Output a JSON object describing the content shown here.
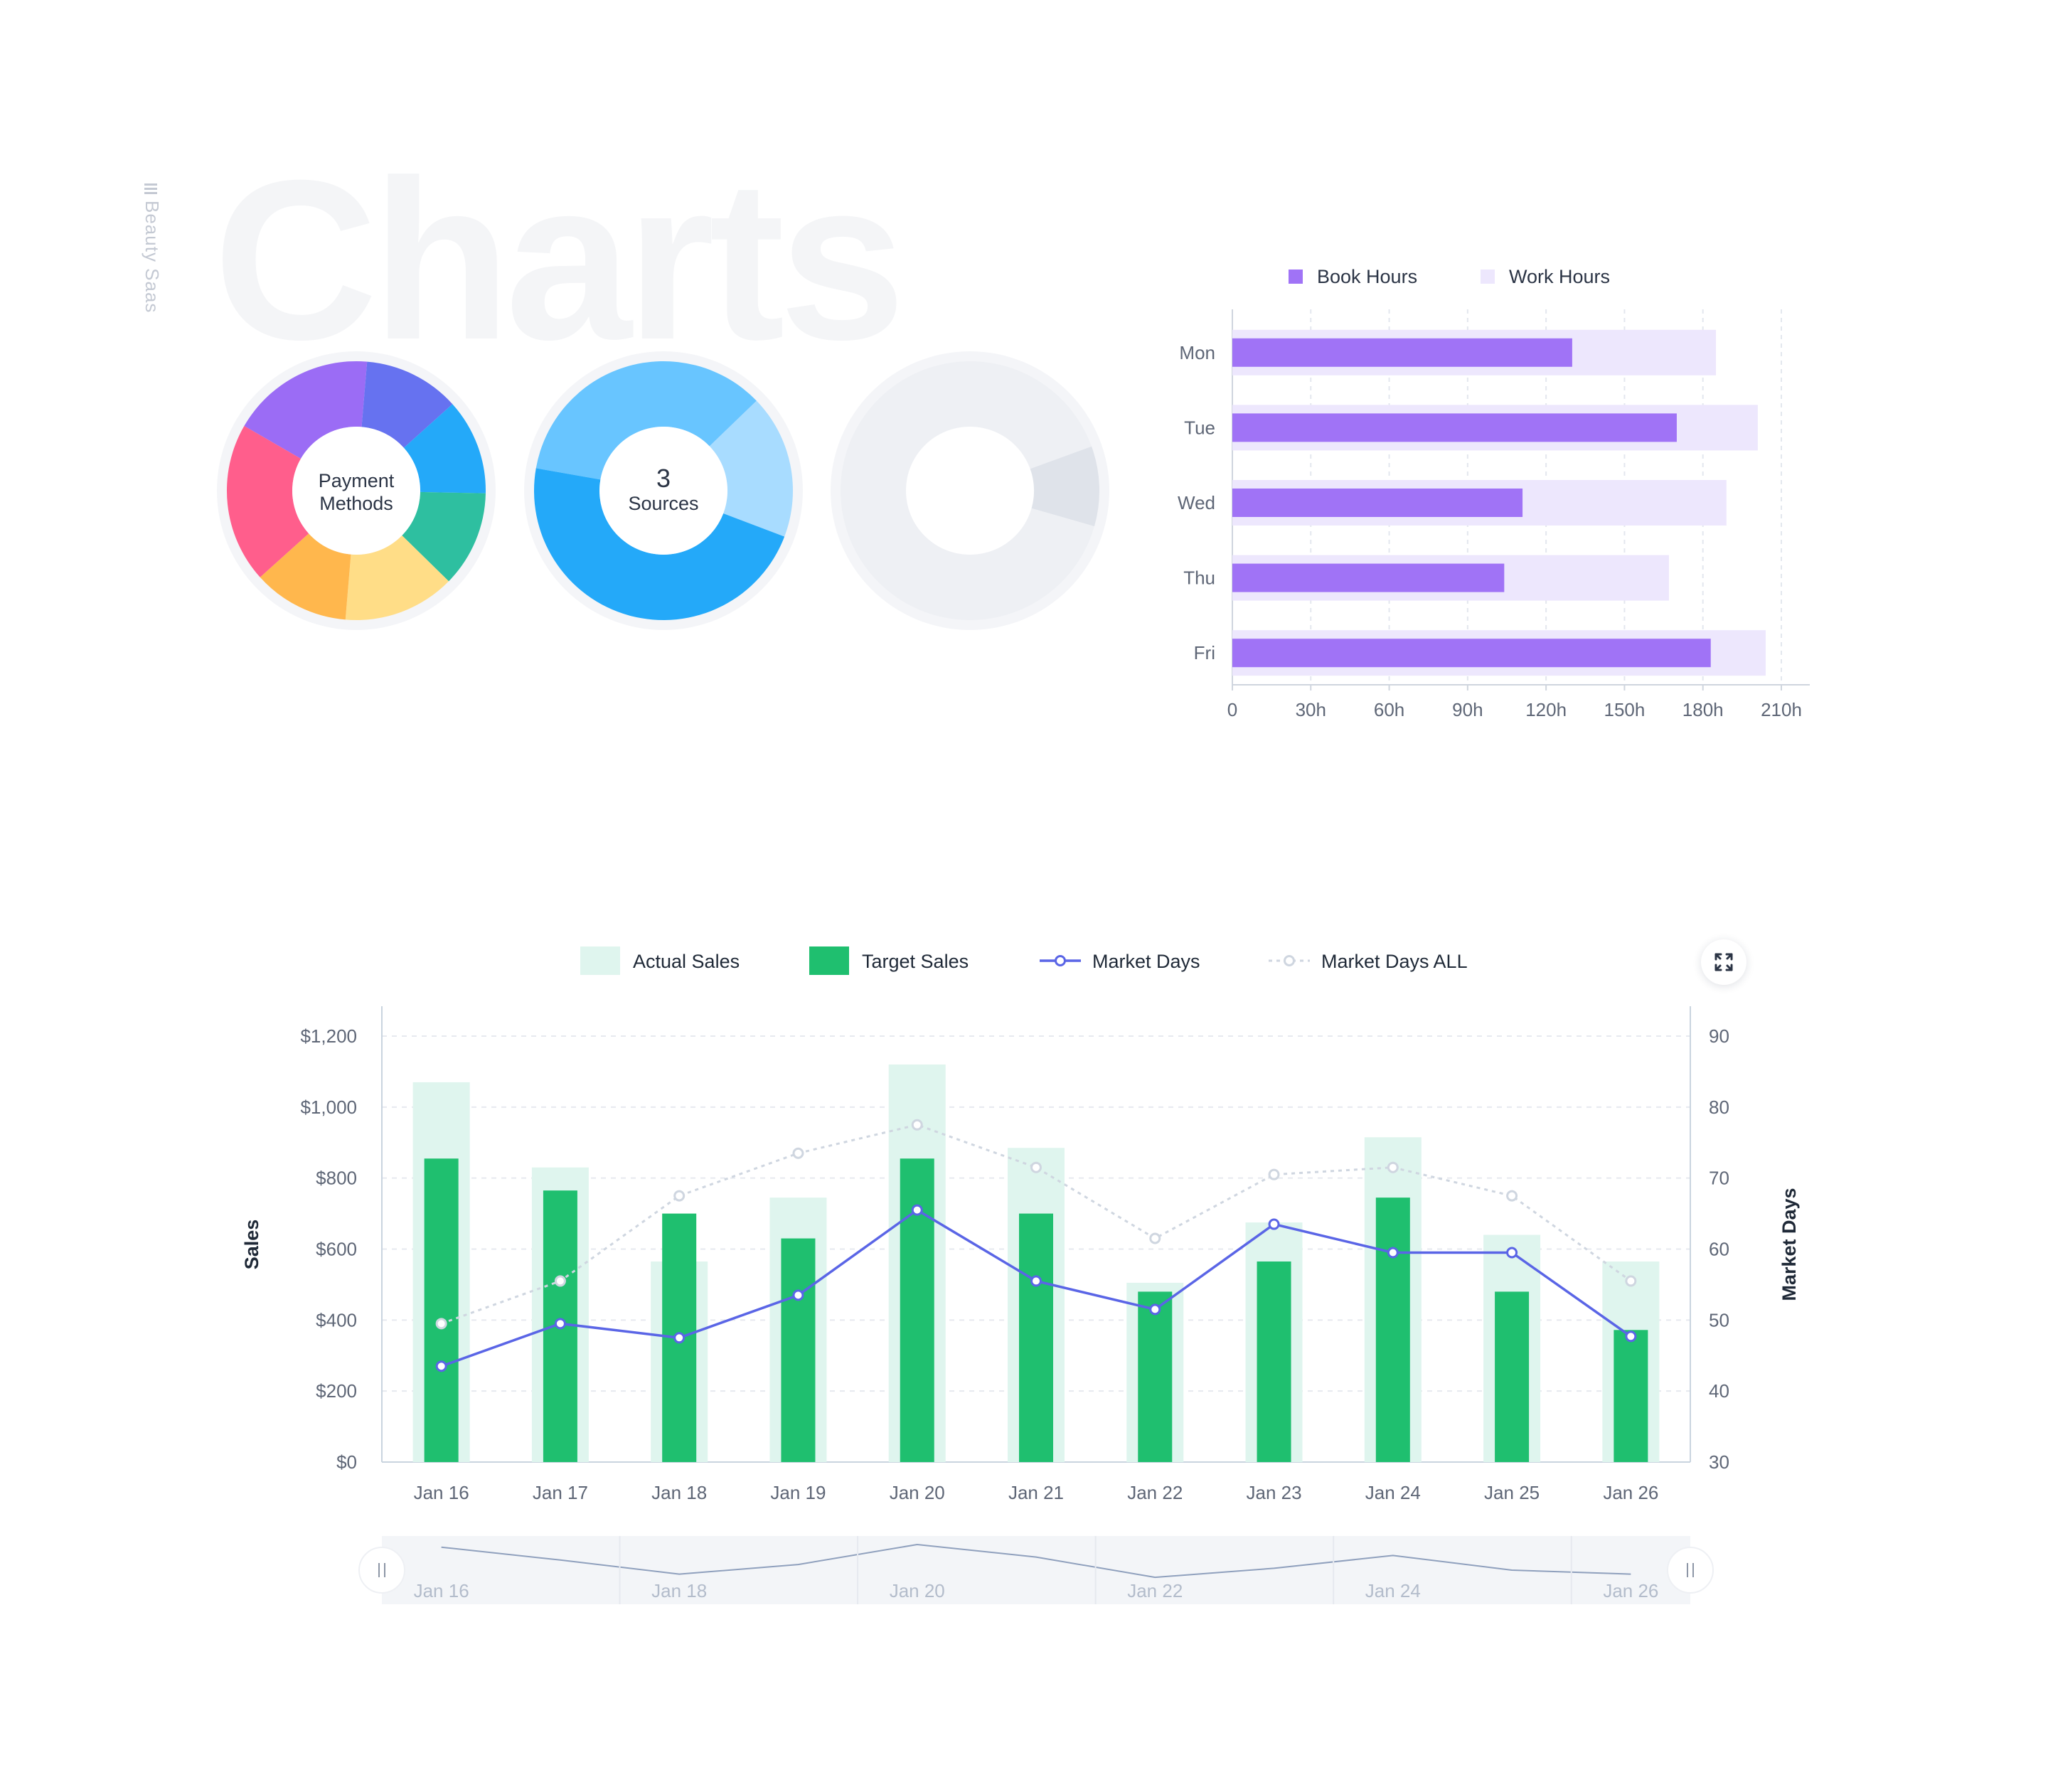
{
  "brand": {
    "label": "Beauty Saas"
  },
  "page_title": "Charts",
  "expand_icon": "expand-icon",
  "chart_data": [
    {
      "type": "pie",
      "variant": "donut",
      "center_label": [
        "Payment",
        "Methods"
      ],
      "slices": [
        {
          "value": 18,
          "color": "#9b6cf5"
        },
        {
          "value": 12,
          "color": "#6672f0"
        },
        {
          "value": 12,
          "color": "#24a9f9"
        },
        {
          "value": 12,
          "color": "#2ebfa0"
        },
        {
          "value": 14,
          "color": "#ffdd87"
        },
        {
          "value": 12,
          "color": "#ffb74d"
        },
        {
          "value": 20,
          "color": "#ff5e8c"
        }
      ]
    },
    {
      "type": "pie",
      "variant": "donut",
      "center_value": "3",
      "center_label": "Sources",
      "slices": [
        {
          "value": 35,
          "color": "#68c5ff"
        },
        {
          "value": 18,
          "color": "#a8dcff"
        },
        {
          "value": 47,
          "color": "#24a9f9"
        }
      ]
    },
    {
      "type": "pie",
      "variant": "donut",
      "slices": [
        {
          "value": 10,
          "color": "#dfe3ea"
        },
        {
          "value": 90,
          "color": "#eef0f4"
        }
      ]
    },
    {
      "type": "bar",
      "orientation": "horizontal",
      "categories": [
        "Mon",
        "Tue",
        "Wed",
        "Thu",
        "Fri"
      ],
      "series": [
        {
          "name": "Book Hours",
          "color": "#a073f6",
          "values": [
            130,
            170,
            111,
            104,
            183
          ]
        },
        {
          "name": "Work Hours",
          "color": "#ede7fd",
          "values": [
            185,
            201,
            189,
            167,
            204
          ]
        }
      ],
      "x_ticks": [
        0,
        30,
        60,
        90,
        120,
        150,
        180,
        210
      ],
      "x_tick_labels": [
        "0",
        "30h",
        "60h",
        "90h",
        "120h",
        "150h",
        "180h",
        "210h"
      ],
      "xlim": [
        0,
        210
      ],
      "grid": "vertical dashed",
      "legend": "top"
    },
    {
      "type": "bar",
      "categories": [
        "Jan 16",
        "Jan 17",
        "Jan 18",
        "Jan 19",
        "Jan 20",
        "Jan 21",
        "Jan 22",
        "Jan 23",
        "Jan 24",
        "Jan 25",
        "Jan 26"
      ],
      "series": [
        {
          "name": "Actual Sales",
          "type": "bar",
          "axis": "left",
          "color": "#dff5ee",
          "values": [
            1070,
            830,
            565,
            745,
            1120,
            885,
            505,
            675,
            915,
            640,
            565
          ]
        },
        {
          "name": "Target Sales",
          "type": "bar",
          "axis": "left",
          "color": "#1fbf6f",
          "values": [
            855,
            765,
            700,
            630,
            855,
            700,
            480,
            565,
            745,
            480,
            372
          ]
        },
        {
          "name": "Market Days",
          "type": "line",
          "axis": "right",
          "color": "#5a65e6",
          "values": [
            43.5,
            49.5,
            47.5,
            53.5,
            65.5,
            55.5,
            51.5,
            63.5,
            59.5,
            59.5,
            47.7
          ]
        },
        {
          "name": "Market Days ALL",
          "type": "line",
          "axis": "right",
          "style": "dashed",
          "color": "#cfd6e0",
          "values": [
            49.5,
            55.5,
            67.5,
            73.5,
            77.5,
            71.5,
            61.5,
            70.5,
            71.5,
            67.5,
            55.5
          ]
        }
      ],
      "ylabel": "Sales",
      "ylim": [
        0,
        1200
      ],
      "y_ticks": [
        "$0",
        "$200",
        "$400",
        "$600",
        "$800",
        "$1,000",
        "$1,200"
      ],
      "y2label": "Market Days",
      "y2lim": [
        30,
        90
      ],
      "y2_ticks": [
        "30",
        "40",
        "50",
        "60",
        "70",
        "80",
        "90"
      ],
      "grid": "horizontal dashed",
      "legend": "top-center",
      "overview": {
        "tick_labels": [
          "Jan 16",
          "Jan 18",
          "Jan 20",
          "Jan 22",
          "Jan 24",
          "Jan 26"
        ],
        "tick_indices": [
          0,
          2,
          4,
          6,
          8,
          10
        ]
      }
    }
  ]
}
